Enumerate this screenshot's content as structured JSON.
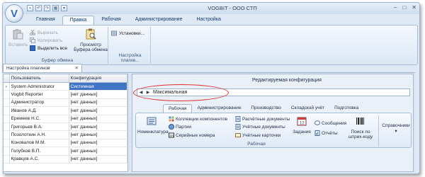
{
  "app": {
    "title": "VOGBIT - ООО СТП"
  },
  "menu_tabs": [
    {
      "label": "Главная"
    },
    {
      "label": "Правка"
    },
    {
      "label": "Рабочая"
    },
    {
      "label": "Администрирование"
    },
    {
      "label": "Настройка"
    }
  ],
  "ribbon": {
    "paste": "Вставить",
    "cut": "Вырезать",
    "copy": "Копировать",
    "select_all": "Выделить все",
    "preview_line1": "Просмотр",
    "preview_line2": "Буфера обмена",
    "clipboard_group": "Буфер обмена",
    "plugin_settings_btn": "Установки...",
    "plugin_settings_group": "Настройка плагив..."
  },
  "doc_tab": {
    "label": "Настройка плагинов",
    "close": "✕"
  },
  "grid": {
    "columns": [
      "Пользователь",
      "Конфигурация"
    ],
    "rows": [
      {
        "user": "System Administrator",
        "config": "Системная"
      },
      {
        "user": "Vogbit Reporter",
        "config": "[нет данных]"
      },
      {
        "user": "Администратор",
        "config": "[нет данных]"
      },
      {
        "user": "Иванов А.Д.",
        "config": "[нет данных]"
      },
      {
        "user": "Еремеев Н.С.",
        "config": "[нет данных]"
      },
      {
        "user": "Григорьев В.А.",
        "config": "[нет данных]"
      },
      {
        "user": "Позолоткин А.Н.",
        "config": "[нет данных]"
      },
      {
        "user": "Коновалов М.М.",
        "config": "[нет данных]"
      },
      {
        "user": "Голубков В.П.",
        "config": "[нет данных]"
      },
      {
        "user": "Кравцов А.С.",
        "config": "[нет данных]"
      }
    ],
    "current_row_marker": "›"
  },
  "config_panel": {
    "title": "Редактируемая конфигурация",
    "value": "Максимальная",
    "tabs": [
      {
        "label": "Рабочая"
      },
      {
        "label": "Администрирование"
      },
      {
        "label": "Производство"
      },
      {
        "label": "Складской учёт"
      },
      {
        "label": "Подготовка"
      }
    ],
    "buttons": {
      "nomenclature": "Номенклатура",
      "component_collections": "Коллекции компонентов",
      "batches": "Партии",
      "serial_numbers": "Серийные номера",
      "settlement_docs": "Расчётные документы",
      "accounting_docs": "Учётные документы",
      "accounting_cards": "Учётные карточки",
      "tasks": "Задания",
      "messages": "Сообщения",
      "reports": "Отчёты",
      "barcode_search_l1": "Поиск по",
      "barcode_search_l2": "штрих-коду",
      "references": "Справочники"
    },
    "group_title": "Рабочая"
  }
}
